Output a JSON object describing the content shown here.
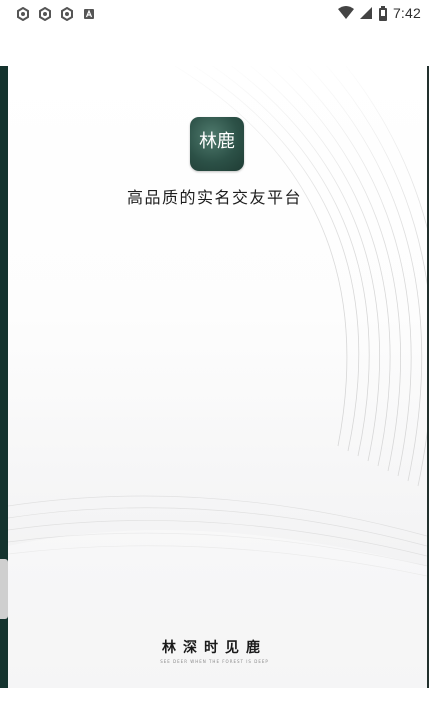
{
  "status_bar": {
    "left_icons": [
      "settings-icon",
      "settings-icon",
      "settings-icon",
      "notification-icon"
    ],
    "time": "7:42",
    "right_icons": [
      "wifi-icon",
      "signal-icon",
      "battery-icon"
    ]
  },
  "splash": {
    "logo_text": "林鹿",
    "tagline": "高品质的实名交友平台",
    "slogan": "林深时见鹿",
    "slogan_subtitle": "SEE DEER WHEN THE FOREST IS DEEP"
  },
  "colors": {
    "logo_bg": "#2c5147",
    "left_strip": "#14332e",
    "text_primary": "#1e1e1e"
  }
}
